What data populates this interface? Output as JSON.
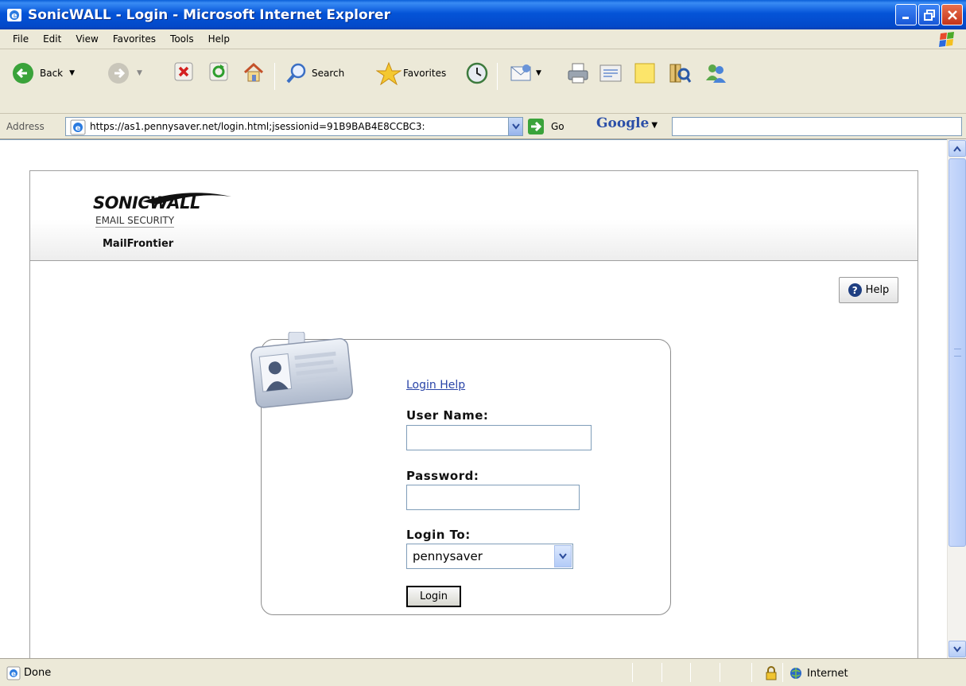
{
  "window": {
    "title": "SonicWALL - Login - Microsoft Internet Explorer"
  },
  "menu": [
    "File",
    "Edit",
    "View",
    "Favorites",
    "Tools",
    "Help"
  ],
  "toolbar": {
    "back_label": "Back",
    "search_label": "Search",
    "favorites_label": "Favorites"
  },
  "address": {
    "label": "Address",
    "url": "https://as1.pennysaver.net/login.html;jsessionid=91B9BAB4E8CCBC3:",
    "go_label": "Go",
    "google_label": "Google"
  },
  "page": {
    "logo_brand": "SONICWALL",
    "logo_sub": "EMAIL SECURITY",
    "logo_product": "MailFrontier",
    "help_label": "Help",
    "login_help_link": "Login Help",
    "username_label": "User Name:",
    "username_value": "",
    "password_label": "Password:",
    "password_value": "",
    "login_to_label": "Login To:",
    "login_to_selected": "pennysaver",
    "login_button": "Login"
  },
  "status": {
    "text": "Done",
    "zone": "Internet"
  },
  "colors": {
    "titlebar": "#0454d8",
    "link": "#2a45a8",
    "chrome": "#ece9d8"
  }
}
